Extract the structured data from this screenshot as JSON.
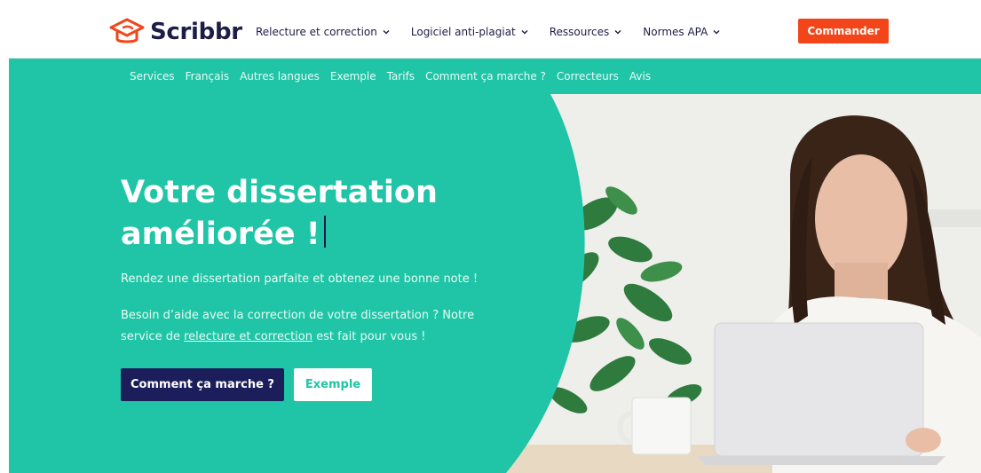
{
  "brand": {
    "name": "Scribbr",
    "text_color": "#1d1d47",
    "accent": "#f2461a",
    "teal": "#1fc5a6",
    "navy": "#1c1e5b"
  },
  "nav": {
    "items": [
      {
        "label": "Relecture et correction"
      },
      {
        "label": "Logiciel anti-plagiat"
      },
      {
        "label": "Ressources"
      },
      {
        "label": "Normes APA"
      }
    ],
    "order_label": "Commander"
  },
  "subnav": {
    "items": [
      {
        "label": "Services"
      },
      {
        "label": "Français"
      },
      {
        "label": "Autres langues"
      },
      {
        "label": "Exemple"
      },
      {
        "label": "Tarifs"
      },
      {
        "label": "Comment ça marche ?"
      },
      {
        "label": "Correcteurs"
      },
      {
        "label": "Avis"
      }
    ]
  },
  "hero": {
    "title_line1": "Votre dissertation",
    "title_line2": "améliorée !",
    "subtitle": "Rendez une dissertation parfaite et obtenez une bonne note !",
    "desc_before": "Besoin d’aide avec la correction de votre dissertation ? Notre service de ",
    "desc_link": "relecture et correction",
    "desc_after": " est fait pour vous !",
    "primary_button": "Comment ça marche ?",
    "secondary_button": "Exemple"
  }
}
